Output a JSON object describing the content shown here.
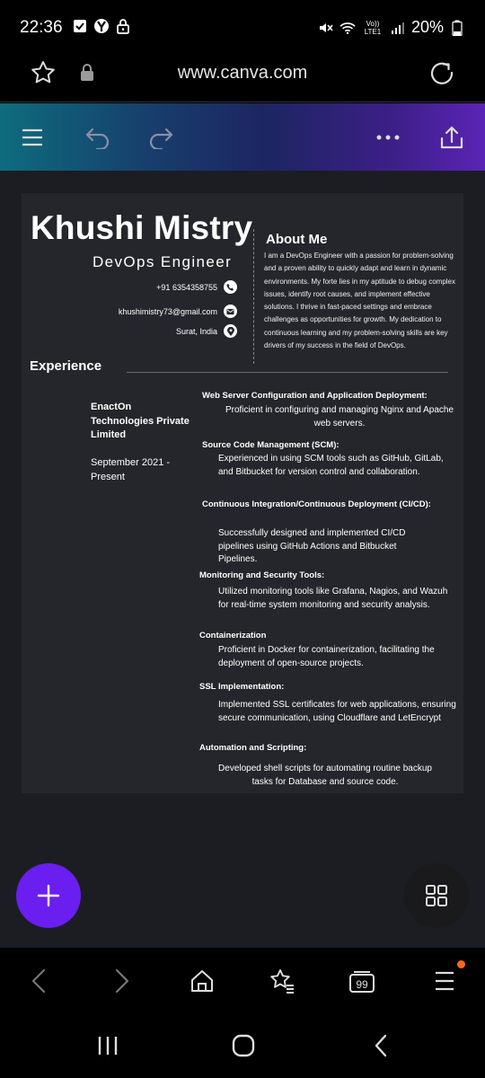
{
  "status_bar": {
    "time": "22:36",
    "battery": "20%",
    "volte": "Vo)) LTE1"
  },
  "browser": {
    "url": "www.canva.com"
  },
  "resume": {
    "name": "Khushi Mistry",
    "role": "DevOps Engineer",
    "phone": "+91 6354358755",
    "email": "khushimistry73@gmail.com",
    "location": "Surat, India",
    "about_title": "About Me",
    "about_text": "I am a DevOps Engineer with a passion for problem-solving and a proven ability to quickly adapt and learn in dynamic environments. My forte lies in my aptitude to debug complex issues, identify root causes, and implement effective solutions. I thrive in fast-paced settings and embrace challenges as opportunities for growth. My dedication to continuous learning and my problem-solving skills are key drivers of my success in the field of DevOps.",
    "experience_title": "Experience",
    "company": "EnactOn Technologies Private Limited",
    "period": "September 2021 - Present",
    "sections": [
      {
        "heading": "Web Server Configuration and Application Deployment:",
        "text": "Proficient in configuring and managing Nginx and Apache web servers."
      },
      {
        "heading": "Source Code Management (SCM):",
        "text": "Experienced in using SCM tools such as GitHub, GitLab, and Bitbucket for version control and collaboration."
      },
      {
        "heading": "Continuous Integration/Continuous Deployment (CI/CD):",
        "text": "Successfully designed and implemented CI/CD pipelines using GitHub Actions and Bitbucket Pipelines."
      },
      {
        "heading": "Monitoring and Security Tools:",
        "text": "Utilized monitoring tools like Grafana, Nagios, and Wazuh for real-time system monitoring and security analysis."
      },
      {
        "heading": "Containerization",
        "text": "Proficient in Docker for containerization, facilitating the deployment of open-source projects."
      },
      {
        "heading": "SSL Implementation:",
        "text": "Implemented SSL certificates for web applications, ensuring secure communication, using Cloudflare and LetEncrypt"
      },
      {
        "heading": "Automation and Scripting:",
        "text": "Developed shell scripts for automating routine backup tasks for Database and source code."
      }
    ]
  },
  "browser_nav": {
    "tabs_count": "99"
  },
  "icons": {
    "url_bar": [
      "star-icon",
      "lock-icon",
      "reload-icon"
    ],
    "toolbar": [
      "menu-icon",
      "undo-icon",
      "redo-icon",
      "more-icon",
      "share-icon"
    ],
    "contact": [
      "phone-icon",
      "email-icon",
      "location-icon"
    ],
    "browser_nav": [
      "back-icon",
      "forward-icon",
      "home-icon",
      "bookmark-icon",
      "tabs-icon",
      "menu-icon"
    ],
    "system_nav": [
      "recents-icon",
      "home-icon",
      "back-icon"
    ]
  },
  "colors": {
    "fab_add": "#6a1ef0",
    "page_bg": "#25262b",
    "editor_bg": "#1c1d22",
    "notification_dot": "#ff6a13"
  }
}
